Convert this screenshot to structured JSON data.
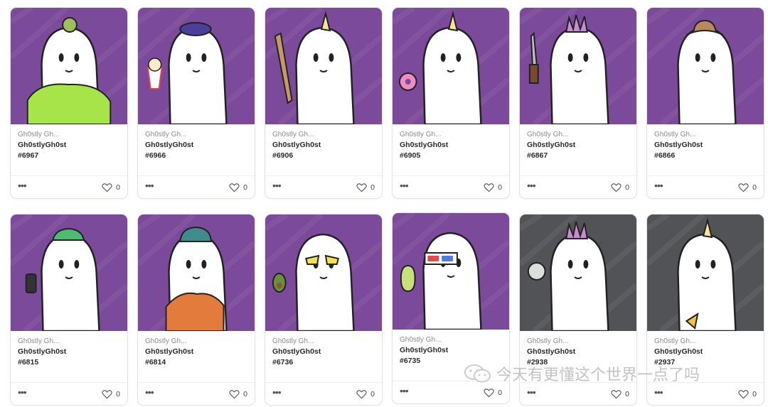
{
  "colors": {
    "purple_bg": "#7b4a9b",
    "gray_bg": "#525357",
    "card_border": "#e3e3e3"
  },
  "cards": [
    {
      "collection": "Gh0stly Gh...",
      "title": "Gh0stlyGh0st",
      "token": "#6967",
      "likes": "0",
      "bg": "purple",
      "accessory": "green-sweater-and-snail-hat"
    },
    {
      "collection": "Gh0stly Gh...",
      "title": "Gh0stlyGh0st",
      "token": "#6966",
      "likes": "0",
      "bg": "purple",
      "accessory": "beret-and-popcorn"
    },
    {
      "collection": "Gh0stly Gh...",
      "title": "Gh0stlyGh0st",
      "token": "#6906",
      "likes": "0",
      "bg": "purple",
      "accessory": "unicorn-horn-and-bat"
    },
    {
      "collection": "Gh0stly Gh...",
      "title": "Gh0stlyGh0st",
      "token": "#6905",
      "likes": "0",
      "bg": "purple",
      "accessory": "unicorn-horn-and-donut"
    },
    {
      "collection": "Gh0stly Gh...",
      "title": "Gh0stlyGh0st",
      "token": "#6867",
      "likes": "0",
      "bg": "purple",
      "accessory": "mohawk-and-knife"
    },
    {
      "collection": "Gh0stly Gh...",
      "title": "Gh0stlyGh0st",
      "token": "#6866",
      "likes": "0",
      "bg": "purple",
      "accessory": "cowboy-hat"
    },
    {
      "collection": "Gh0stly Gh...",
      "title": "Gh0stlyGh0st",
      "token": "#6815",
      "likes": "0",
      "bg": "purple",
      "accessory": "green-cap-and-phone"
    },
    {
      "collection": "Gh0stly Gh...",
      "title": "Gh0stlyGh0st",
      "token": "#6814",
      "likes": "0",
      "bg": "purple",
      "accessory": "beanie-and-jacket"
    },
    {
      "collection": "Gh0stly Gh...",
      "title": "Gh0stlyGh0st",
      "token": "#6736",
      "likes": "0",
      "bg": "purple",
      "accessory": "sunglasses-and-avocado"
    },
    {
      "collection": "Gh0stly Gh...",
      "title": "Gh0stlyGh0st",
      "token": "#6735",
      "likes": "0",
      "bg": "purple",
      "accessory": "3d-glasses-and-potion"
    },
    {
      "collection": "Gh0stly Gh...",
      "title": "Gh0stlyGh0st",
      "token": "#2938",
      "likes": "0",
      "bg": "gray",
      "accessory": "mohawk-and-moon"
    },
    {
      "collection": "Gh0stly Gh...",
      "title": "Gh0stlyGh0st",
      "token": "#2937",
      "likes": "0",
      "bg": "gray",
      "accessory": "unicorn-horn-and-pizza"
    }
  ],
  "more_icon": "more-dots-icon",
  "like_icon": "heart-outline-icon",
  "watermark": {
    "text": "今天有更懂这个世界一点了吗",
    "icon": "wechat-icon"
  }
}
